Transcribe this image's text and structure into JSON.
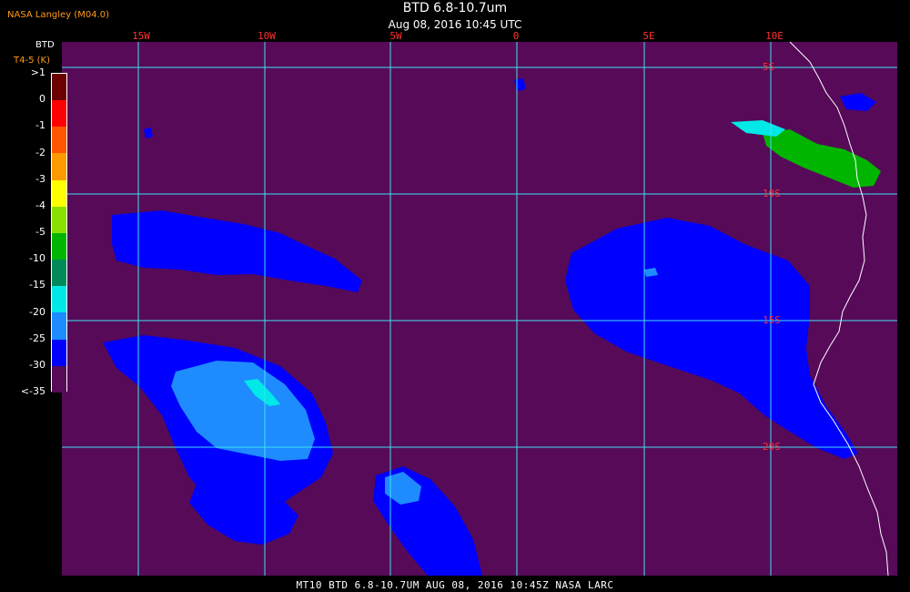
{
  "header": {
    "source": "NASA Langley (M04.0)",
    "title": "BTD 6.8-10.7um",
    "subtitle": "Aug 08, 2016 10:45 UTC"
  },
  "legend": {
    "title": "BTD",
    "subtitle": "T4-5 (K)",
    "labels": [
      ">1",
      "0",
      "-1",
      "-2",
      "-3",
      "-4",
      "-5",
      "-10",
      "-15",
      "-20",
      "-25",
      "-30",
      "<-35"
    ],
    "colors": [
      "#6b0000",
      "#ff0000",
      "#ff5500",
      "#ff9900",
      "#ffff00",
      "#88e000",
      "#00b400",
      "#008a5a",
      "#00e8e8",
      "#1e8cff",
      "#0000ff",
      "#560a58"
    ]
  },
  "grid": {
    "lon_labels": [
      "15W",
      "10W",
      "5W",
      "0",
      "5E",
      "10E"
    ],
    "lat_labels": [
      "5S",
      "10S",
      "15S",
      "20S"
    ],
    "line_color": "#40e0f0"
  },
  "colors": {
    "background": "#560a58",
    "coastline": "#ffffff",
    "cloud_deep_blue": "#0000ff",
    "cloud_light_blue": "#1e8cff",
    "cloud_cyan": "#00e8e8",
    "cloud_green": "#00b400"
  },
  "footer": {
    "text": "MT10  BTD 6.8-10.7UM   AUG 08, 2016 10:45Z   NASA LARC"
  }
}
